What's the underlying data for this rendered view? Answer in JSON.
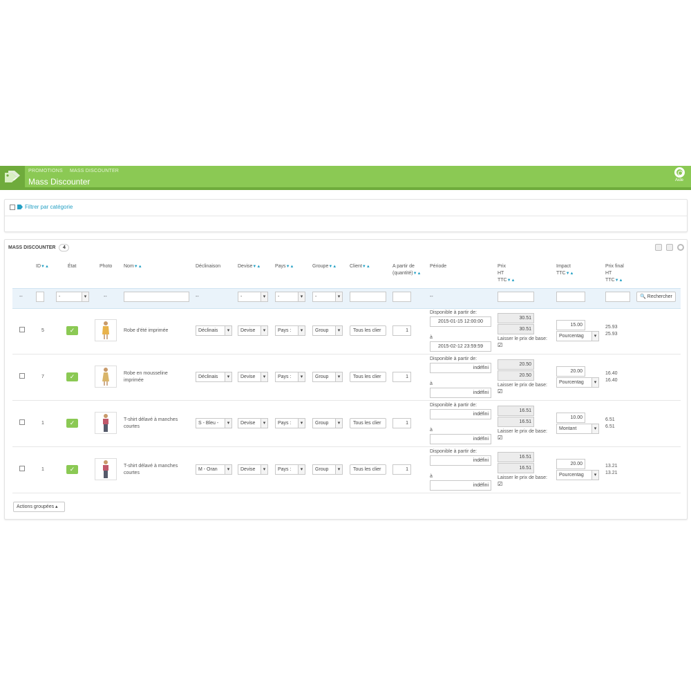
{
  "header": {
    "breadcrumb": [
      "PROMOTIONS",
      "MASS DISCOUNTER"
    ],
    "title": "Mass Discounter",
    "help_label": "Aide",
    "accent_color": "#8bc954"
  },
  "filter": {
    "label": "Filtrer par catégorie"
  },
  "list": {
    "title": "MASS DISCOUNTER",
    "count": "4",
    "columns": {
      "id": "ID",
      "etat": "État",
      "photo": "Photo",
      "nom": "Nom",
      "declinaison": "Déclinaison",
      "devise": "Devise",
      "pays": "Pays",
      "groupe": "Groupe",
      "client": "Client",
      "partir1": "A partir de",
      "partir2": "(quantité)",
      "periode": "Période",
      "prix1": "Prix",
      "prix2": "HT",
      "prix3": "TTC",
      "impact1": "Impact",
      "impact2": "TTC",
      "final1": "Prix final",
      "final2": "HT",
      "final3": "TTC"
    },
    "filters": {
      "dash": "--",
      "etat_value": "-",
      "select_value": "-",
      "search_label": "Rechercher"
    },
    "labels": {
      "dispo": "Disponible à partir de:",
      "a": "à",
      "laisser": "Laisser le prix de base:"
    },
    "rows": [
      {
        "id": "5",
        "name": "Robe d'été imprimée",
        "declinaison": "Déclinais",
        "devise": "Devise",
        "pays": "Pays :",
        "groupe": "Group",
        "client": "Tous les clier",
        "quantity": "1",
        "from": "2015-01-15 12:00:00",
        "to": "2015-02-12 23:59:59",
        "price_ht": "30.51",
        "price_ttc": "30.51",
        "impact": "15.00",
        "impact_type": "Pourcentag",
        "final_ht": "25.93",
        "final_ttc": "25.93"
      },
      {
        "id": "7",
        "name": "Robe en mousseline imprimée",
        "declinaison": "Déclinais",
        "devise": "Devise",
        "pays": "Pays :",
        "groupe": "Group",
        "client": "Tous les clier",
        "quantity": "1",
        "from": "indéfini",
        "to": "indéfini",
        "price_ht": "20.50",
        "price_ttc": "20.50",
        "impact": "20.00",
        "impact_type": "Pourcentag",
        "final_ht": "16.40",
        "final_ttc": "16.40"
      },
      {
        "id": "1",
        "name": "T-shirt délavé à manches courtes",
        "declinaison": "S - Bleu -",
        "devise": "Devise",
        "pays": "Pays :",
        "groupe": "Group",
        "client": "Tous les clier",
        "quantity": "1",
        "from": "indéfini",
        "to": "indéfini",
        "price_ht": "16.51",
        "price_ttc": "16.51",
        "impact": "10.00",
        "impact_type": "Montant",
        "final_ht": "6.51",
        "final_ttc": "6.51"
      },
      {
        "id": "1",
        "name": "T-shirt délavé à manches courtes",
        "declinaison": "M - Oran",
        "devise": "Devise",
        "pays": "Pays :",
        "groupe": "Group",
        "client": "Tous les clier",
        "quantity": "1",
        "from": "indéfini",
        "to": "indéfini",
        "price_ht": "16.51",
        "price_ttc": "16.51",
        "impact": "20.00",
        "impact_type": "Pourcentag",
        "final_ht": "13.21",
        "final_ttc": "13.21"
      }
    ],
    "bulk_actions_label": "Actions groupées"
  }
}
